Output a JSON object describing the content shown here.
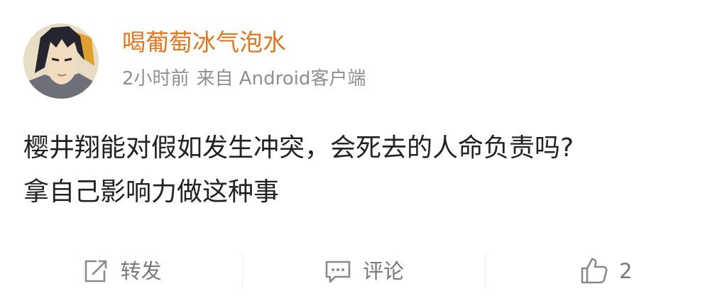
{
  "post": {
    "author": "喝葡萄冰气泡水",
    "time": "2小时前",
    "source": "来自 Android客户端",
    "content_lines": [
      "樱井翔能对假如发生冲突，会死去的人命负责吗?",
      "拿自己影响力做这种事"
    ]
  },
  "actions": {
    "repost_label": "转发",
    "comment_label": "评论",
    "like_count": "2"
  },
  "icons": {
    "repost": "edit-share-icon",
    "comment": "comment-bubble-icon",
    "like": "thumbs-up-icon"
  },
  "colors": {
    "username": "#e2761c",
    "meta": "#8f8f8f",
    "text": "#222222",
    "action": "#7a7a7a"
  }
}
